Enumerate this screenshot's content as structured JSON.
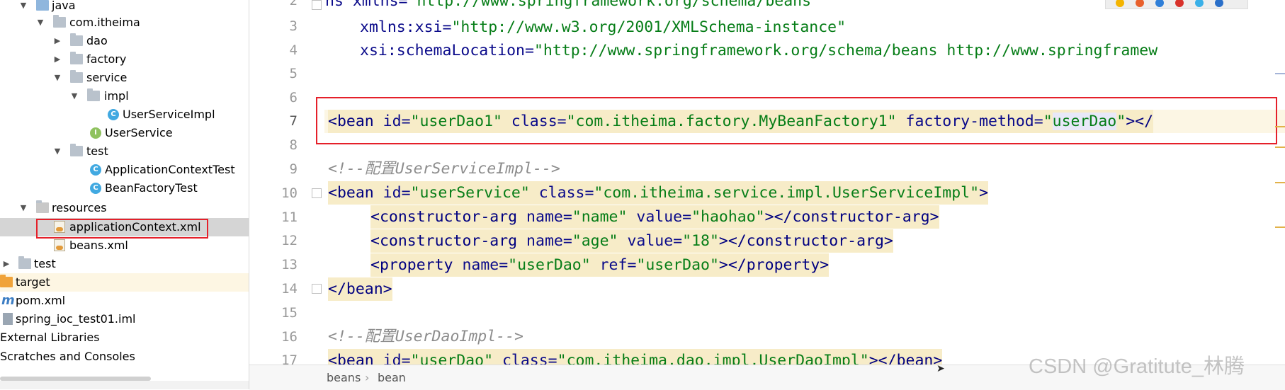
{
  "project_tree": {
    "items": [
      {
        "label": "java"
      },
      {
        "label": "com.itheima"
      },
      {
        "label": "dao"
      },
      {
        "label": "factory"
      },
      {
        "label": "service"
      },
      {
        "label": "impl"
      },
      {
        "label": "UserServiceImpl"
      },
      {
        "label": "UserService"
      },
      {
        "label": "test"
      },
      {
        "label": "ApplicationContextTest"
      },
      {
        "label": "BeanFactoryTest"
      },
      {
        "label": "resources"
      },
      {
        "label": "applicationContext.xml"
      },
      {
        "label": "beans.xml"
      },
      {
        "label": "test"
      },
      {
        "label": "target"
      },
      {
        "label": "pom.xml"
      },
      {
        "label": "spring_ioc_test01.iml"
      },
      {
        "label": "External Libraries"
      },
      {
        "label": "Scratches and Consoles"
      }
    ],
    "icons": {
      "class_letter": "C",
      "interface_letter": "I",
      "maven_letter": "m"
    }
  },
  "editor": {
    "line_numbers": [
      "2",
      "3",
      "4",
      "5",
      "6",
      "7",
      "8",
      "9",
      "10",
      "11",
      "12",
      "13",
      "14",
      "15",
      "16",
      "17"
    ],
    "lines": {
      "l2": [
        "ns xmlns=",
        "\"http://www.springframework.org/schema/beans\""
      ],
      "l3": [
        "xmlns:xsi=",
        "\"http://www.w3.org/2001/XMLSchema-instance\""
      ],
      "l4": [
        "xsi:schemaLocation=",
        "\"http://www.springframework.org/schema/beans http://www.springframew"
      ],
      "l7": [
        "<bean",
        " id=",
        "\"userDao1\"",
        " class=",
        "\"com.itheima.factory.MyBeanFactory1\"",
        " factory-method=",
        "\"",
        "userDao",
        "\"",
        "></"
      ],
      "l9": "<!--配置UserServiceImpl-->",
      "l10": [
        "<bean",
        " id=",
        "\"userService\"",
        " class=",
        "\"com.itheima.service.impl.UserServiceImpl\"",
        ">"
      ],
      "l11": [
        "<constructor-arg",
        " name=",
        "\"name\"",
        " value=",
        "\"haohao\"",
        "></constructor-arg>"
      ],
      "l12": [
        "<constructor-arg",
        " name=",
        "\"age\"",
        " value=",
        "\"18\"",
        "></constructor-arg>"
      ],
      "l13": [
        "<property",
        " name=",
        "\"userDao\"",
        " ref=",
        "\"userDao\"",
        "></property>"
      ],
      "l14": "</bean>",
      "l16": "<!--配置UserDaoImpl-->",
      "l17": [
        "<bean",
        " id=",
        "\"userDao\"",
        " class=",
        "\"com.itheima.dao.impl.UserDaoImpl\"",
        "></bean>"
      ]
    }
  },
  "breadcrumb": {
    "items": [
      "beans",
      "bean"
    ],
    "separator": "›"
  },
  "watermark": "CSDN @Gratitute_林腾",
  "colors": {
    "highlight_box": "#e5202a",
    "tag": "#000080",
    "value": "#067d17",
    "comment": "#8c8c8c"
  }
}
